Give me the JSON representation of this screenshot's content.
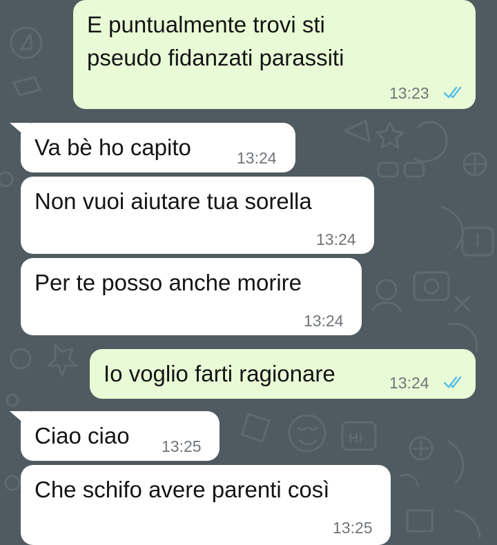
{
  "chat": {
    "accent_tick_color": "#53bdeb",
    "outgoing_bubble_color": "#e8fbd6",
    "incoming_bubble_color": "#ffffff",
    "wallpaper_color": "#4f5b60",
    "messages": [
      {
        "direction": "out",
        "lines": [
          "E puntualmente trovi sti",
          "pseudo fidanzati parassiti"
        ],
        "time": "13:23",
        "status": "read"
      },
      {
        "direction": "in",
        "lines": [
          "Va bè ho capito"
        ],
        "time": "13:24"
      },
      {
        "direction": "in",
        "lines": [
          "Non vuoi aiutare tua sorella"
        ],
        "time": "13:24"
      },
      {
        "direction": "in",
        "lines": [
          "Per te posso anche morire"
        ],
        "time": "13:24"
      },
      {
        "direction": "out",
        "lines": [
          "Io voglio farti ragionare"
        ],
        "time": "13:24",
        "status": "read"
      },
      {
        "direction": "in",
        "lines": [
          "Ciao ciao"
        ],
        "time": "13:25"
      },
      {
        "direction": "in",
        "lines": [
          "Che schifo avere parenti così"
        ],
        "time": "13:25"
      }
    ]
  },
  "wallpaper_doodles": {
    "hi_sign": "Hi"
  }
}
